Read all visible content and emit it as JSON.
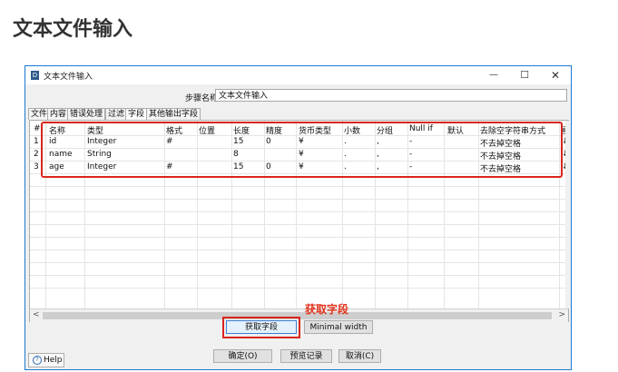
{
  "page": {
    "title": "文本文件输入"
  },
  "window": {
    "title": "文本文件输入",
    "minimize": "—",
    "maximize": "☐",
    "close": "✕"
  },
  "step": {
    "label": "步骤名称",
    "value": "文本文件输入"
  },
  "tabs": [
    "文件",
    "内容",
    "错误处理",
    "过滤",
    "字段",
    "其他输出字段"
  ],
  "active_tab": "字段",
  "table": {
    "headers": [
      "#",
      "名称",
      "类型",
      "格式",
      "位置",
      "长度",
      "精度",
      "货币类型",
      "小数",
      "分组",
      "Null if",
      "默认",
      "去除空字符串方式",
      "重"
    ],
    "rows": [
      [
        "1",
        "id",
        "Integer",
        "#",
        "",
        "15",
        "0",
        "¥",
        ".",
        ",",
        "-",
        "",
        "不去掉空格",
        "↓"
      ],
      [
        "2",
        "name",
        "String",
        "",
        "",
        "8",
        "",
        "¥",
        ".",
        ",",
        "-",
        "",
        "不去掉空格",
        "↓"
      ],
      [
        "3",
        "age",
        "Integer",
        "#",
        "",
        "15",
        "0",
        "¥",
        ".",
        ",",
        "-",
        "",
        "不去掉空格",
        "↓"
      ]
    ]
  },
  "annotation": "获取字段",
  "buttons": {
    "get_fields": "获取字段",
    "minimal_width": "Minimal width",
    "ok": "确定(O)",
    "preview": "预览记录",
    "cancel": "取消(C)",
    "help": "Help"
  },
  "colors": {
    "accent": "#1c78d6",
    "annotation": "#d9261c"
  }
}
